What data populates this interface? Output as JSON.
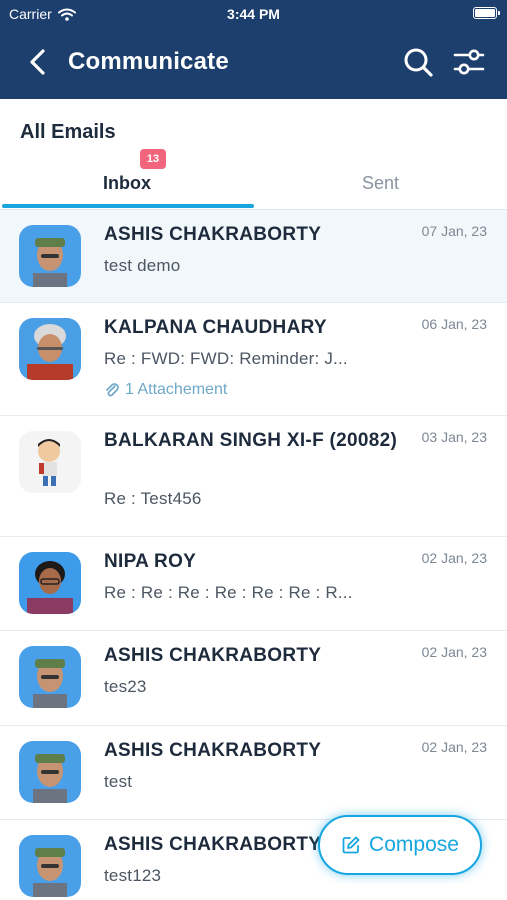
{
  "status_bar": {
    "carrier": "Carrier",
    "time": "3:44 PM"
  },
  "header": {
    "title": "Communicate",
    "back_icon": "chevron-left-icon",
    "search_icon": "search-icon",
    "filter_icon": "sliders-icon"
  },
  "section_title": "All Emails",
  "tabs": [
    {
      "label": "Inbox",
      "active": true,
      "badge": "13"
    },
    {
      "label": "Sent",
      "active": false
    }
  ],
  "emails": [
    {
      "name": "ASHIS CHAKRABORTY",
      "date": "07 Jan, 23",
      "subject": "test demo",
      "avatar": "photo-man-cap"
    },
    {
      "name": "KALPANA CHAUDHARY",
      "date": "06 Jan, 23",
      "subject": "Re : FWD: FWD: Reminder: J...",
      "attachment": "1 Attachement",
      "avatar": "photo-woman-grey-hair"
    },
    {
      "name": "BALKARAN SINGH XI-F (20082)",
      "date": "03 Jan, 23",
      "subject": "Re : Test456",
      "avatar": "cartoon-schoolboy"
    },
    {
      "name": "NIPA ROY",
      "date": "02 Jan, 23",
      "subject": "Re : Re : Re : Re : Re : Re : R...",
      "avatar": "photo-woman-glasses"
    },
    {
      "name": "ASHIS CHAKRABORTY",
      "date": "02 Jan, 23",
      "subject": "tes23",
      "avatar": "photo-man-cap"
    },
    {
      "name": "ASHIS CHAKRABORTY",
      "date": "02 Jan, 23",
      "subject": "test",
      "avatar": "photo-man-cap"
    },
    {
      "name": "ASHIS CHAKRABORTY",
      "date": "",
      "subject": "test123",
      "avatar": "photo-man-cap"
    }
  ],
  "compose": {
    "label": "Compose",
    "icon": "edit-icon"
  },
  "colors": {
    "header_bg": "#1d3f6e",
    "accent": "#17a6e0",
    "badge": "#f2667d",
    "active_row": "#f1f7fb"
  }
}
